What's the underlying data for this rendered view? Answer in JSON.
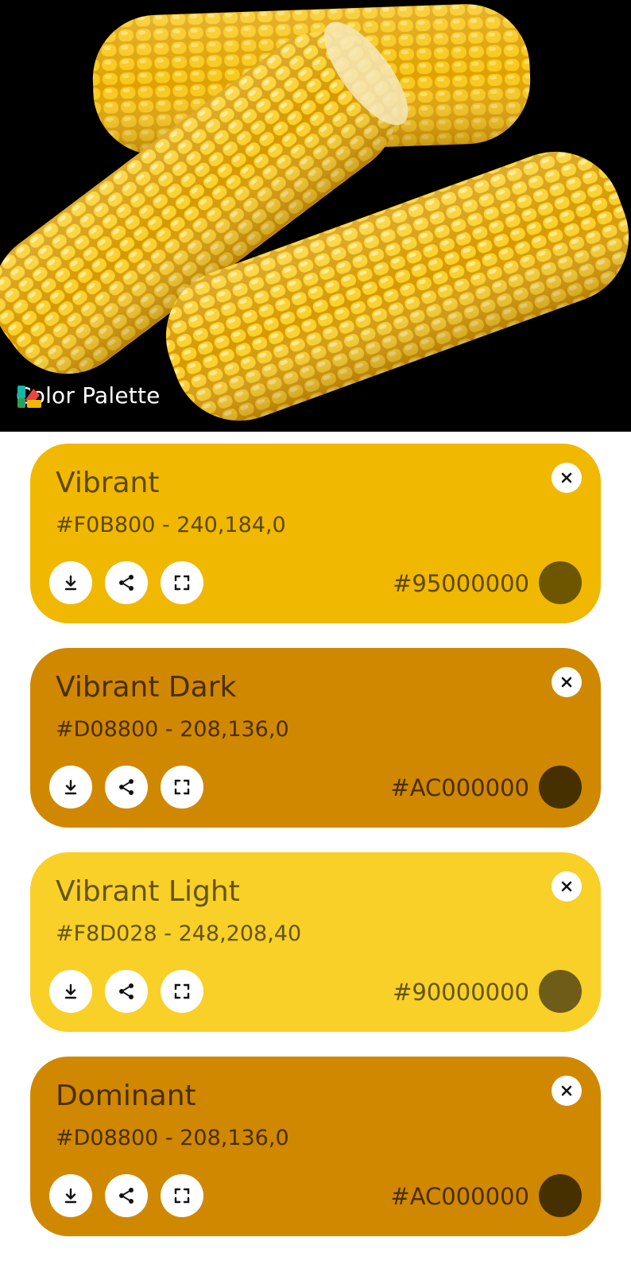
{
  "hero": {
    "watermark_text": "Color Palette",
    "image_description_icon": "corn-photo"
  },
  "cards": [
    {
      "title": "Vibrant",
      "subtitle": "#F0B800 - 240,184,0",
      "overlay_code": "#95000000",
      "bg_color": "#F0B800",
      "text_color": "#5E4800",
      "swatch_color": "#6E5600"
    },
    {
      "title": "Vibrant Dark",
      "subtitle": "#D08800 - 208,136,0",
      "overlay_code": "#AC000000",
      "bg_color": "#D08800",
      "text_color": "#4A2E00",
      "swatch_color": "#473000"
    },
    {
      "title": "Vibrant Light",
      "subtitle": "#F8D028 - 248,208,40",
      "overlay_code": "#90000000",
      "bg_color": "#F8D028",
      "text_color": "#655414",
      "swatch_color": "#6F5C18"
    },
    {
      "title": "Dominant",
      "subtitle": "#D08800 - 208,136,0",
      "overlay_code": "#AC000000",
      "bg_color": "#D08800",
      "text_color": "#4A2E00",
      "swatch_color": "#473000"
    }
  ],
  "icons": {
    "close": "close-icon",
    "download": "download-icon",
    "share": "share-icon",
    "fullscreen": "fullscreen-icon"
  }
}
